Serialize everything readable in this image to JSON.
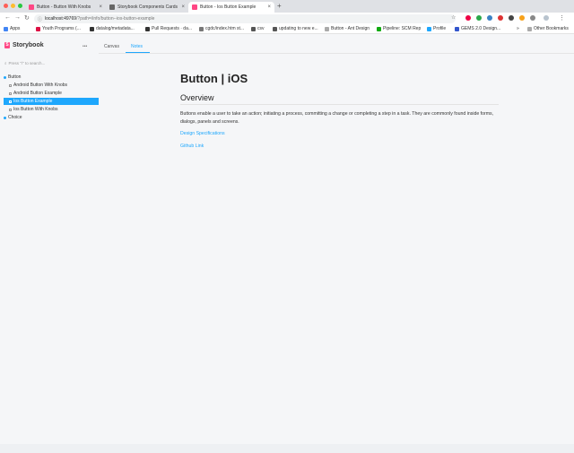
{
  "browser": {
    "tabs": [
      {
        "label": "Button - Button With Knobs",
        "color": "#ff4785"
      },
      {
        "label": "Storybook Components Cards",
        "color": "#666666"
      },
      {
        "label": "Button - Ios Button Example",
        "color": "#ff4785"
      }
    ],
    "address": {
      "host": "localhost:49769",
      "path": "/?path=/info/button--ios-button-example"
    },
    "bookmarks": [
      "Apps",
      "Youth Programs (...",
      "datalog/metadata...",
      "Pull Requests · da...",
      "cgdc/index.htm st...",
      "csv",
      "updating to new e...",
      "Button - Ant Design",
      "Pipeline: SCM Rep",
      "Profile",
      "GEMS 2.0 Design...",
      "Other Bookmarks"
    ]
  },
  "storybook": {
    "logo": "Storybook",
    "menu": "•••",
    "tabs": [
      "Canvas",
      "Notes"
    ],
    "search_placeholder": "Press \"/\" to search...",
    "tree": [
      {
        "label": "Button",
        "level": 0,
        "selected": false
      },
      {
        "label": "Android Button With Knobs",
        "level": 1,
        "selected": false
      },
      {
        "label": "Android Button Example",
        "level": 1,
        "selected": false
      },
      {
        "label": "Ios Button Example",
        "level": 1,
        "selected": true
      },
      {
        "label": "Ios Button With Knobs",
        "level": 1,
        "selected": false
      },
      {
        "label": "Choice",
        "level": 0,
        "selected": false
      }
    ]
  },
  "doc": {
    "title": "Button | iOS",
    "overview": "Overview",
    "body": "Buttons enable a user to take an action; initiating a process, committing a change or completing a step in a task. They are commonly found inside forms, dialogs, panels and screens.",
    "links": [
      "Design Specifications",
      "Github Link"
    ]
  }
}
